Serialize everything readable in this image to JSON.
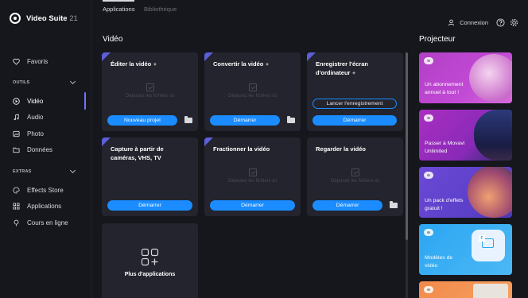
{
  "app": {
    "name": "Video Suite",
    "version": "21"
  },
  "tabs": [
    {
      "label": "Applications",
      "active": true
    },
    {
      "label": "Bibliothèque",
      "active": false
    }
  ],
  "header": {
    "login_label": "Connexion"
  },
  "sidebar": {
    "favorites_label": "Favoris",
    "tools_title": "OUTILS",
    "tools": [
      {
        "label": "Vidéo",
        "icon": "play-circle-icon",
        "active": true
      },
      {
        "label": "Audio",
        "icon": "music-note-icon"
      },
      {
        "label": "Photo",
        "icon": "image-icon"
      },
      {
        "label": "Données",
        "icon": "folder-icon"
      }
    ],
    "extras_title": "EXTRAS",
    "extras": [
      {
        "label": "Effects Store",
        "icon": "palette-icon"
      },
      {
        "label": "Applications",
        "icon": "grid-icon"
      },
      {
        "label": "Cours en ligne",
        "icon": "bulb-icon"
      }
    ]
  },
  "main": {
    "title": "Vidéo",
    "drop_hint": "Déposez les fichiers ici",
    "cards": [
      {
        "title": "Éditer la vidéo",
        "button": "Nouveau projet"
      },
      {
        "title": "Convertir la vidéo",
        "button": "Démarrer"
      },
      {
        "title": "Enregistrer l'écran d'ordinateur",
        "outline_button": "Lancer l'enregistrement",
        "button": "Démarrer"
      },
      {
        "title": "Capture à partir de caméras, VHS, TV",
        "button": "Démarrer"
      },
      {
        "title": "Fractionner la vidéo",
        "button": "Démarrer"
      },
      {
        "title": "Regarder la vidéo",
        "button": "Démarrer"
      }
    ],
    "more_apps_label": "Plus d'applications"
  },
  "projector": {
    "title": "Projecteur",
    "tiles": [
      {
        "text": "Un abonnement annuel à tout !",
        "color": "#b23fc5"
      },
      {
        "text": "Passer à Movavi Unlimited",
        "color": "#a92ec0"
      },
      {
        "text": "Un pack d'effets gratuit !",
        "color": "#6b49d6"
      },
      {
        "text": "Modèles de vidéo",
        "color": "#2ba6f2"
      },
      {
        "text": "",
        "color": "#f28a4a"
      }
    ]
  },
  "colors": {
    "accent": "#1a8cff",
    "corner": "#5d5fd9",
    "background": "#16171d",
    "card": "#23242d"
  }
}
